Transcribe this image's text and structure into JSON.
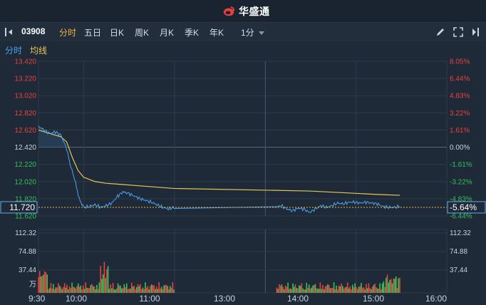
{
  "brand": {
    "name": "华盛通"
  },
  "toolbar": {
    "symbol": "03908",
    "periods": [
      "分时",
      "五日",
      "日K",
      "周K",
      "月K",
      "季K",
      "年K"
    ],
    "active_period": "分时",
    "interval": "1分"
  },
  "legend": {
    "minute": "分时",
    "avg": "均线"
  },
  "colors": {
    "up": "#e8413d",
    "down": "#34c05a",
    "price_line": "#4aa3f0",
    "avg_line": "#e6c65a",
    "current": "#f0b23e",
    "bg": "#1f2a38"
  },
  "chart_data": {
    "type": "line",
    "left_axis_labels": [
      "13.420",
      "13.220",
      "13.020",
      "12.820",
      "12.620",
      "12.420",
      "12.220",
      "12.020",
      "11.820",
      "11.620"
    ],
    "right_axis_labels": [
      "8.05%",
      "6.44%",
      "4.83%",
      "3.22%",
      "1.61%",
      "0.00%",
      "-1.61%",
      "-3.22%",
      "-4.83%",
      "-6.44%"
    ],
    "prev_close": 12.42,
    "current_price": "11.720",
    "current_change": "-5.64%",
    "x_labels": [
      "9:30",
      "10:00",
      "11:00",
      "13:00",
      "14:00",
      "15:00",
      "16:00"
    ],
    "volume_axis_labels": [
      "112.32",
      "74.88",
      "37.44",
      "万"
    ],
    "price_series": [
      [
        0,
        12.66
      ],
      [
        5,
        12.62
      ],
      [
        10,
        12.58
      ],
      [
        15,
        12.6
      ],
      [
        20,
        12.56
      ],
      [
        25,
        12.4
      ],
      [
        28,
        12.22
      ],
      [
        32,
        12.05
      ],
      [
        36,
        11.82
      ],
      [
        40,
        11.72
      ],
      [
        45,
        11.73
      ],
      [
        50,
        11.75
      ],
      [
        55,
        11.72
      ],
      [
        60,
        11.74
      ],
      [
        65,
        11.77
      ],
      [
        70,
        11.85
      ],
      [
        75,
        11.9
      ],
      [
        80,
        11.88
      ],
      [
        85,
        11.85
      ],
      [
        90,
        11.82
      ],
      [
        95,
        11.8
      ],
      [
        100,
        11.78
      ],
      [
        105,
        11.75
      ],
      [
        110,
        11.72
      ],
      [
        115,
        11.7
      ],
      [
        120,
        11.72
      ],
      [
        125,
        11.74
      ],
      [
        130,
        11.7
      ],
      [
        135,
        11.68
      ],
      [
        140,
        11.71
      ],
      [
        145,
        11.7
      ],
      [
        150,
        11.66
      ],
      [
        155,
        11.7
      ],
      [
        160,
        11.74
      ],
      [
        165,
        11.72
      ],
      [
        170,
        11.74
      ],
      [
        175,
        11.77
      ],
      [
        180,
        11.76
      ],
      [
        185,
        11.78
      ],
      [
        190,
        11.78
      ],
      [
        195,
        11.77
      ],
      [
        200,
        11.78
      ],
      [
        205,
        11.77
      ],
      [
        210,
        11.76
      ],
      [
        215,
        11.73
      ],
      [
        220,
        11.72
      ],
      [
        225,
        11.72
      ],
      [
        230,
        11.73
      ]
    ],
    "avg_series": [
      [
        0,
        12.62
      ],
      [
        10,
        12.58
      ],
      [
        20,
        12.54
      ],
      [
        25,
        12.48
      ],
      [
        30,
        12.3
      ],
      [
        35,
        12.15
      ],
      [
        40,
        12.07
      ],
      [
        50,
        12.02
      ],
      [
        60,
        12.0
      ],
      [
        70,
        11.99
      ],
      [
        90,
        11.97
      ],
      [
        120,
        11.94
      ],
      [
        150,
        11.91
      ],
      [
        180,
        11.89
      ],
      [
        210,
        11.87
      ],
      [
        230,
        11.86
      ]
    ],
    "volume_max": 150
  }
}
